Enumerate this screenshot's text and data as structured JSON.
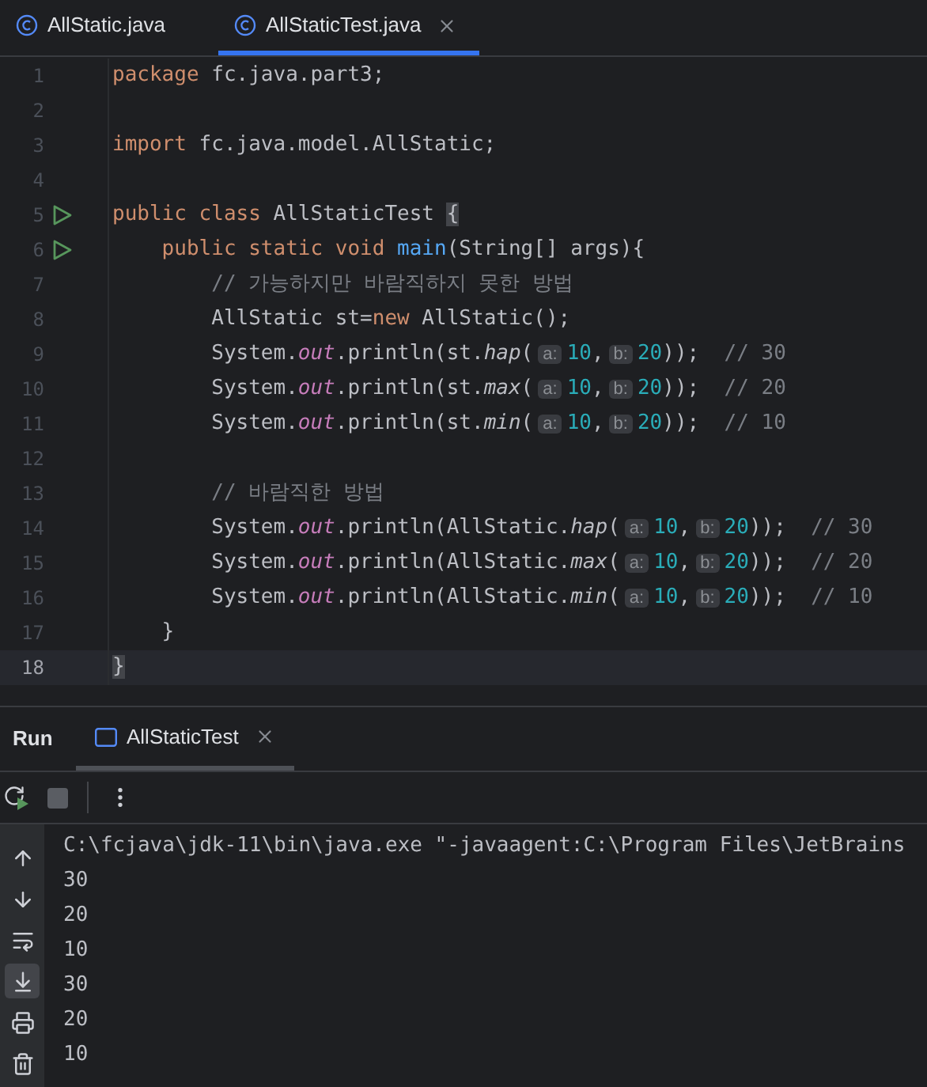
{
  "editor_tabs": [
    {
      "label": "AllStatic.java",
      "selected": false,
      "closable": false
    },
    {
      "label": "AllStaticTest.java",
      "selected": true,
      "closable": true
    }
  ],
  "code_lines": [
    {
      "number": "1",
      "run": false,
      "current": false,
      "tokens": [
        {
          "text": "package",
          "kind": "kw"
        },
        {
          "text": " fc.java.part3;",
          "kind": "plain"
        }
      ]
    },
    {
      "number": "2",
      "run": false,
      "current": false
    },
    {
      "number": "3",
      "run": false,
      "current": false,
      "tokens": [
        {
          "text": "import",
          "kind": "kw"
        },
        {
          "text": " fc.java.model.AllStatic;",
          "kind": "plain"
        }
      ]
    },
    {
      "number": "4",
      "run": false,
      "current": false
    },
    {
      "number": "5",
      "run": true,
      "current": false,
      "tokens": [
        {
          "text": "public class",
          "kind": "kw"
        },
        {
          "text": " AllStaticTest ",
          "kind": "plain"
        },
        {
          "text": "{",
          "kind": "match"
        }
      ]
    },
    {
      "number": "6",
      "run": true,
      "current": false,
      "tokens": [
        {
          "text": "    public static void ",
          "kind": "kw"
        },
        {
          "text": "main",
          "kind": "method"
        },
        {
          "text": "(String[] args){",
          "kind": "plain"
        }
      ]
    },
    {
      "number": "7",
      "run": false,
      "current": false,
      "tokens": [
        {
          "text": "        // 가능하지만 바람직하지 못한 방법",
          "kind": "comment"
        }
      ]
    },
    {
      "number": "8",
      "run": false,
      "current": false,
      "tokens": [
        {
          "text": "        AllStatic st=",
          "kind": "plain"
        },
        {
          "text": "new",
          "kind": "kw"
        },
        {
          "text": " AllStatic();",
          "kind": "plain"
        }
      ]
    },
    {
      "number": "9",
      "run": false,
      "current": false,
      "tokens": [
        {
          "text": "        System.",
          "kind": "plain"
        },
        {
          "text": "out",
          "kind": "field"
        },
        {
          "text": ".println(st.",
          "kind": "plain"
        },
        {
          "text": "hap",
          "kind": "call"
        },
        {
          "text": "(",
          "kind": "plain"
        },
        {
          "text": "a:",
          "kind": "hint"
        },
        {
          "text": "10",
          "kind": "num"
        },
        {
          "text": ",",
          "kind": "plain"
        },
        {
          "text": "b:",
          "kind": "hint"
        },
        {
          "text": "20",
          "kind": "num"
        },
        {
          "text": "));  ",
          "kind": "plain"
        },
        {
          "text": "// 30",
          "kind": "comment"
        }
      ]
    },
    {
      "number": "10",
      "run": false,
      "current": false,
      "tokens": [
        {
          "text": "        System.",
          "kind": "plain"
        },
        {
          "text": "out",
          "kind": "field"
        },
        {
          "text": ".println(st.",
          "kind": "plain"
        },
        {
          "text": "max",
          "kind": "call"
        },
        {
          "text": "(",
          "kind": "plain"
        },
        {
          "text": "a:",
          "kind": "hint"
        },
        {
          "text": "10",
          "kind": "num"
        },
        {
          "text": ",",
          "kind": "plain"
        },
        {
          "text": "b:",
          "kind": "hint"
        },
        {
          "text": "20",
          "kind": "num"
        },
        {
          "text": "));  ",
          "kind": "plain"
        },
        {
          "text": "// 20",
          "kind": "comment"
        }
      ]
    },
    {
      "number": "11",
      "run": false,
      "current": false,
      "tokens": [
        {
          "text": "        System.",
          "kind": "plain"
        },
        {
          "text": "out",
          "kind": "field"
        },
        {
          "text": ".println(st.",
          "kind": "plain"
        },
        {
          "text": "min",
          "kind": "call"
        },
        {
          "text": "(",
          "kind": "plain"
        },
        {
          "text": "a:",
          "kind": "hint"
        },
        {
          "text": "10",
          "kind": "num"
        },
        {
          "text": ",",
          "kind": "plain"
        },
        {
          "text": "b:",
          "kind": "hint"
        },
        {
          "text": "20",
          "kind": "num"
        },
        {
          "text": "));  ",
          "kind": "plain"
        },
        {
          "text": "// 10",
          "kind": "comment"
        }
      ]
    },
    {
      "number": "12",
      "run": false,
      "current": false
    },
    {
      "number": "13",
      "run": false,
      "current": false,
      "tokens": [
        {
          "text": "        // 바람직한 방법",
          "kind": "comment"
        }
      ]
    },
    {
      "number": "14",
      "run": false,
      "current": false,
      "tokens": [
        {
          "text": "        System.",
          "kind": "plain"
        },
        {
          "text": "out",
          "kind": "field"
        },
        {
          "text": ".println(AllStatic.",
          "kind": "plain"
        },
        {
          "text": "hap",
          "kind": "call"
        },
        {
          "text": "(",
          "kind": "plain"
        },
        {
          "text": "a:",
          "kind": "hint"
        },
        {
          "text": "10",
          "kind": "num"
        },
        {
          "text": ",",
          "kind": "plain"
        },
        {
          "text": "b:",
          "kind": "hint"
        },
        {
          "text": "20",
          "kind": "num"
        },
        {
          "text": "));  ",
          "kind": "plain"
        },
        {
          "text": "// 30",
          "kind": "comment"
        }
      ]
    },
    {
      "number": "15",
      "run": false,
      "current": false,
      "tokens": [
        {
          "text": "        System.",
          "kind": "plain"
        },
        {
          "text": "out",
          "kind": "field"
        },
        {
          "text": ".println(AllStatic.",
          "kind": "plain"
        },
        {
          "text": "max",
          "kind": "call"
        },
        {
          "text": "(",
          "kind": "plain"
        },
        {
          "text": "a:",
          "kind": "hint"
        },
        {
          "text": "10",
          "kind": "num"
        },
        {
          "text": ",",
          "kind": "plain"
        },
        {
          "text": "b:",
          "kind": "hint"
        },
        {
          "text": "20",
          "kind": "num"
        },
        {
          "text": "));  ",
          "kind": "plain"
        },
        {
          "text": "// 20",
          "kind": "comment"
        }
      ]
    },
    {
      "number": "16",
      "run": false,
      "current": false,
      "tokens": [
        {
          "text": "        System.",
          "kind": "plain"
        },
        {
          "text": "out",
          "kind": "field"
        },
        {
          "text": ".println(AllStatic.",
          "kind": "plain"
        },
        {
          "text": "min",
          "kind": "call"
        },
        {
          "text": "(",
          "kind": "plain"
        },
        {
          "text": "a:",
          "kind": "hint"
        },
        {
          "text": "10",
          "kind": "num"
        },
        {
          "text": ",",
          "kind": "plain"
        },
        {
          "text": "b:",
          "kind": "hint"
        },
        {
          "text": "20",
          "kind": "num"
        },
        {
          "text": "));  ",
          "kind": "plain"
        },
        {
          "text": "// 10",
          "kind": "comment"
        }
      ]
    },
    {
      "number": "17",
      "run": false,
      "current": false,
      "tokens": [
        {
          "text": "    }",
          "kind": "plain"
        }
      ]
    },
    {
      "number": "18",
      "run": false,
      "current": true,
      "tokens": [
        {
          "text": "}",
          "kind": "match"
        }
      ]
    }
  ],
  "run_panel": {
    "title": "Run",
    "tabs": [
      {
        "label": "AllStaticTest",
        "selected": true
      }
    ],
    "toolbar": [
      {
        "kind": "rerun"
      },
      {
        "kind": "stop"
      },
      {
        "kind": "separator"
      },
      {
        "kind": "more"
      }
    ],
    "side_tools": [
      {
        "kind": "up",
        "selected": false
      },
      {
        "kind": "down",
        "selected": false
      },
      {
        "kind": "wrap",
        "selected": false
      },
      {
        "kind": "scroll_end",
        "selected": true
      },
      {
        "kind": "print",
        "selected": false
      },
      {
        "kind": "trash",
        "selected": false
      }
    ],
    "console_lines": [
      "C:\\fcjava\\jdk-11\\bin\\java.exe \"-javaagent:C:\\Program Files\\JetBrains",
      "30",
      "20",
      "10",
      "30",
      "20",
      "10"
    ]
  }
}
